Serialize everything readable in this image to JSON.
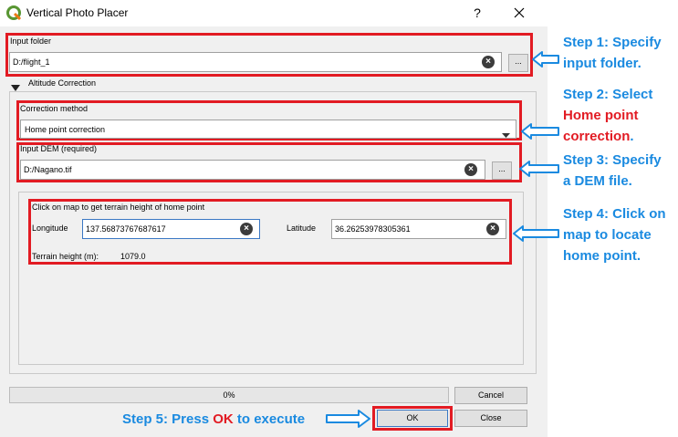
{
  "window": {
    "title": "Vertical Photo Placer",
    "help": "?",
    "close": "close"
  },
  "input_folder": {
    "label": "Input folder",
    "value": "D:/flight_1",
    "browse": "..."
  },
  "altitude": {
    "section_label": "Altitude Correction",
    "method_label": "Correction method",
    "method_value": "Home point correction",
    "dem_label": "Input DEM (required)",
    "dem_value": "D:/Nagano.tif",
    "dem_browse": "...",
    "map_hint": "Click on map to get terrain height of home point",
    "longitude_label": "Longitude",
    "longitude_value": "137.56873767687617",
    "latitude_label": "Latitude",
    "latitude_value": "36.26253978305361",
    "terrain_label": "Terrain height (m):",
    "terrain_value": "1079.0"
  },
  "progress": {
    "text": "0%",
    "value": 0
  },
  "buttons": {
    "cancel": "Cancel",
    "ok": "OK",
    "close": "Close"
  },
  "annotations": {
    "step1": [
      "Step 1: Specify",
      "input folder."
    ],
    "step2_a": "Step 2: Select",
    "step2_b": "Home point",
    "step2_c": "correction",
    "step2_d": ".",
    "step3": [
      "Step 3: Specify",
      "a DEM file."
    ],
    "step4": [
      "Step 4: Click on",
      "map to locate",
      "home point."
    ],
    "step5_a": "Step 5: Press ",
    "step5_b": "OK",
    "step5_c": " to execute"
  },
  "colors": {
    "annotation_blue": "#1a8ae0",
    "highlight_red": "#e21b23"
  }
}
